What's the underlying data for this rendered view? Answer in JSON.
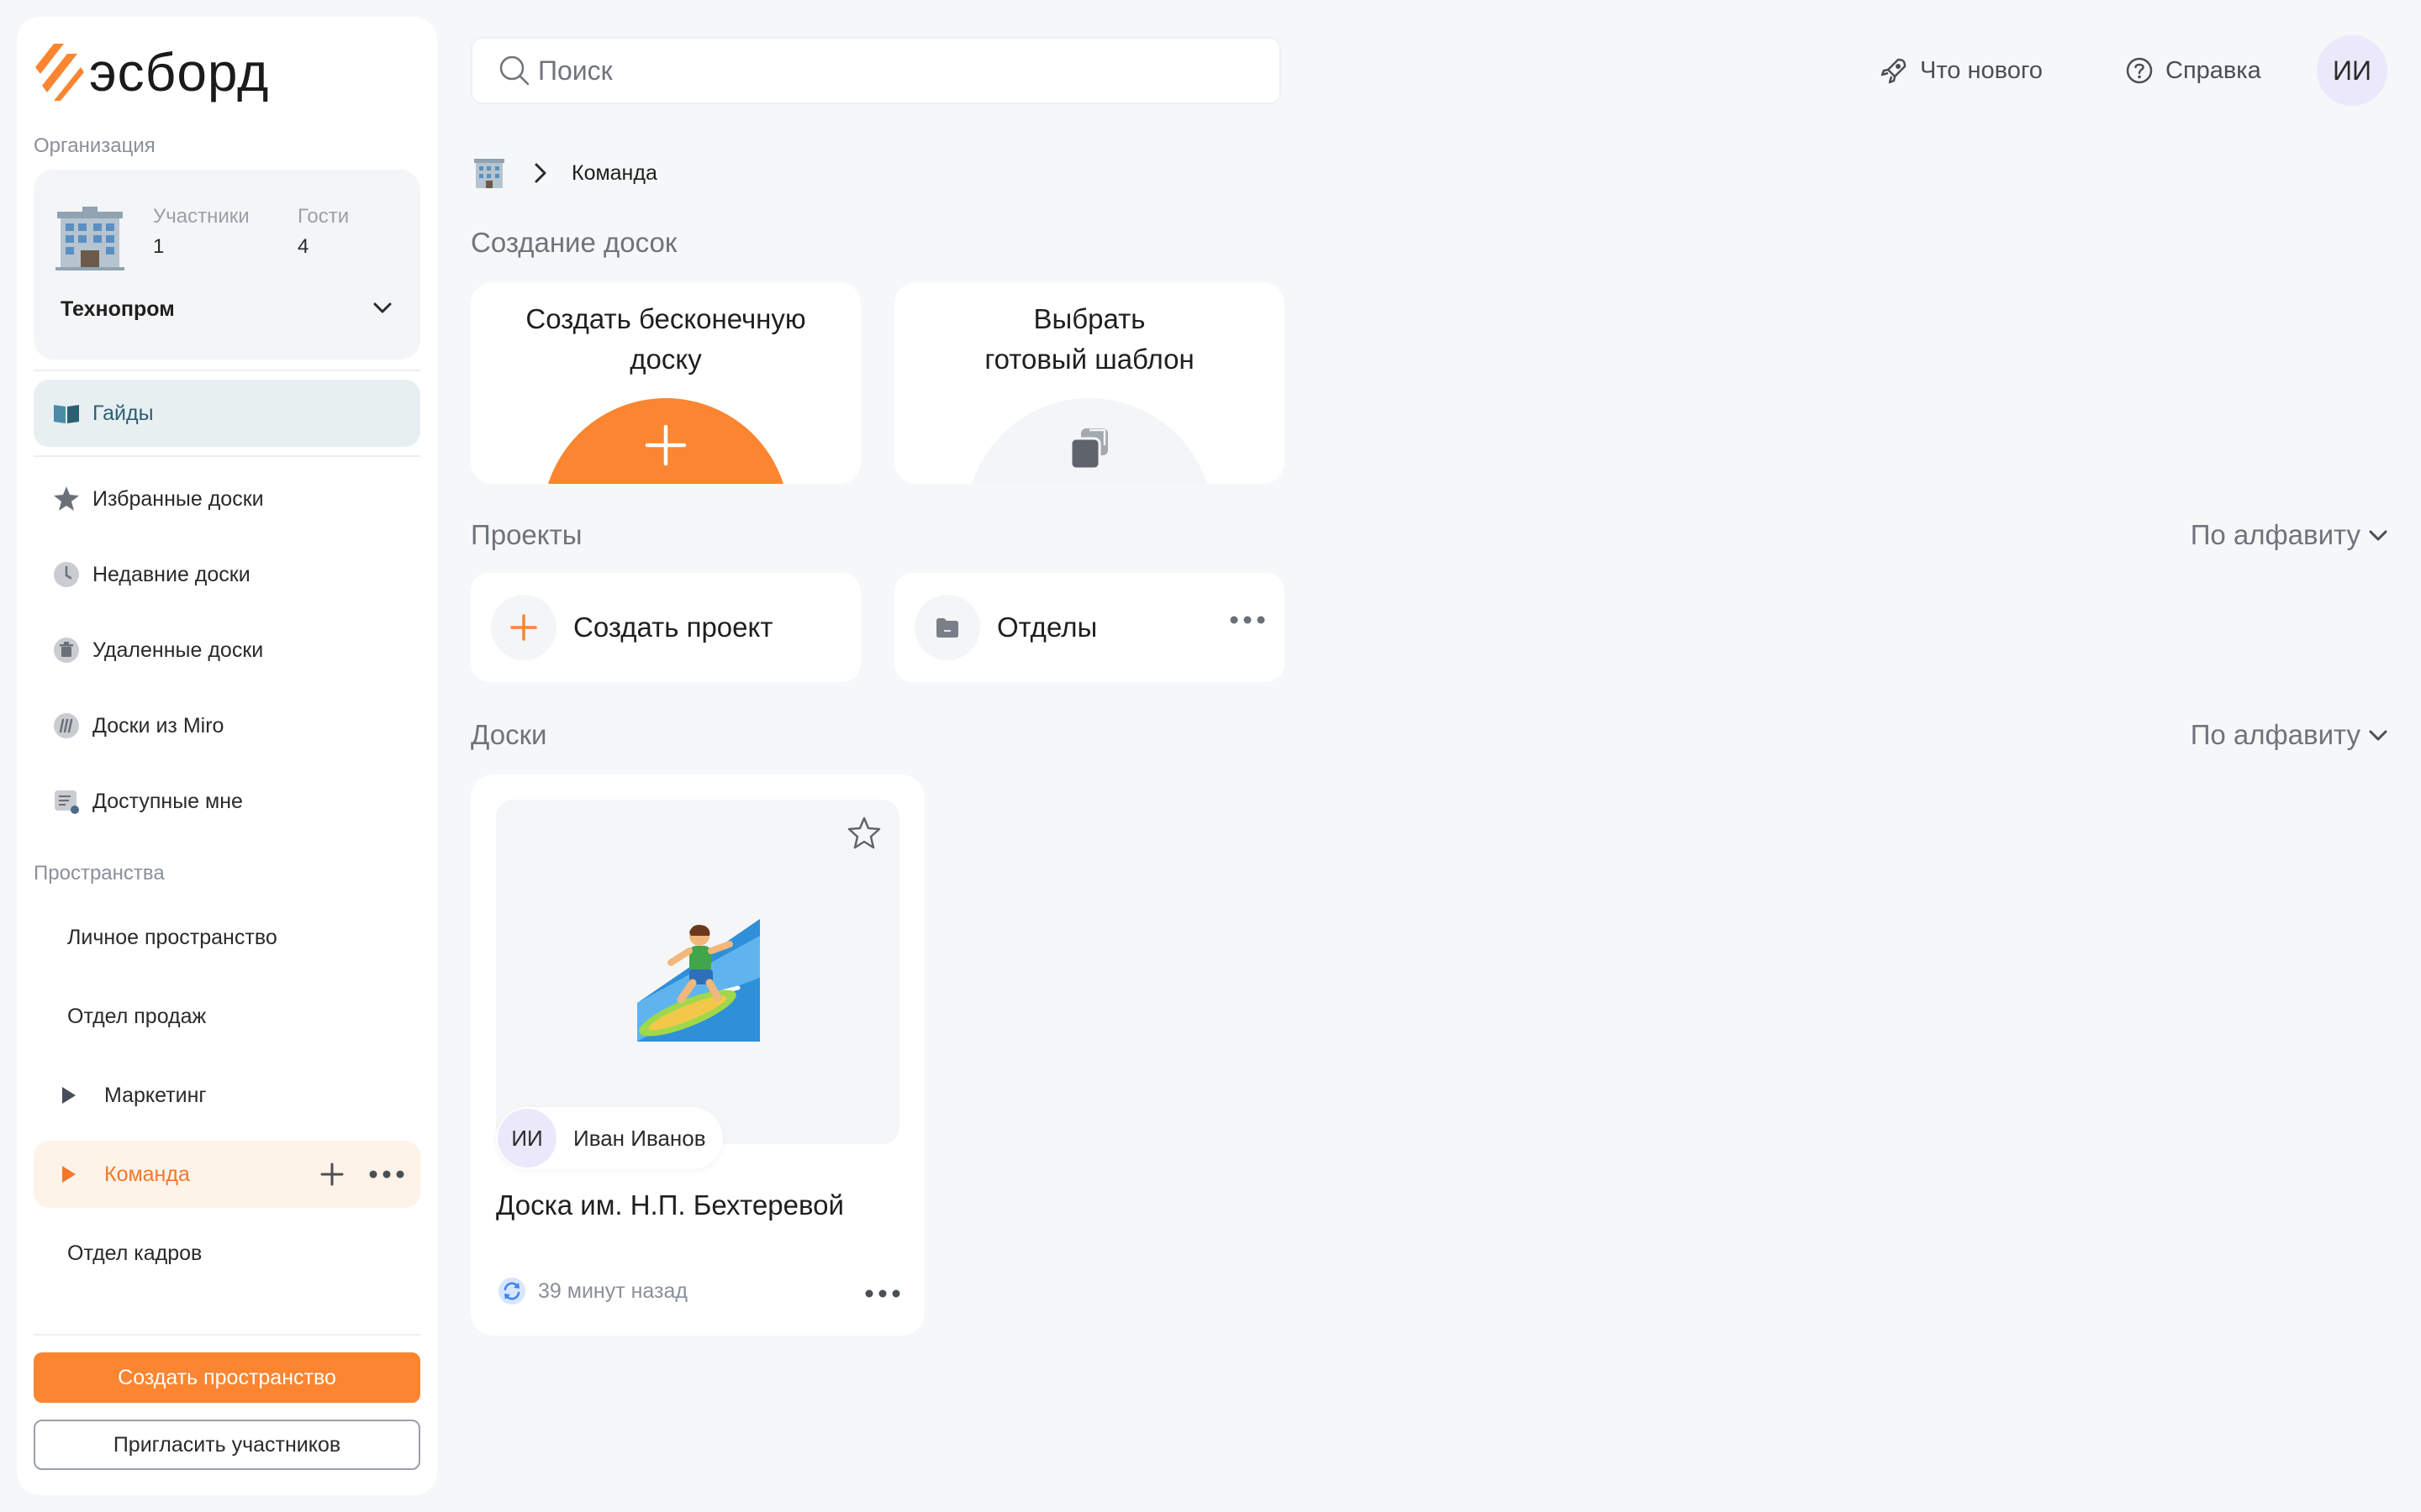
{
  "brand": {
    "name": "эсборд",
    "accent": "#fb8530"
  },
  "sidebar": {
    "org_label": "Организация",
    "org": {
      "members_label": "Участники",
      "members_value": "1",
      "guests_label": "Гости",
      "guests_value": "4",
      "name": "Технопром"
    },
    "guides": "Гайды",
    "nav": [
      {
        "label": "Избранные доски",
        "icon": "star-badge-icon"
      },
      {
        "label": "Недавние доски",
        "icon": "clock-icon"
      },
      {
        "label": "Удаленные доски",
        "icon": "trash-icon"
      },
      {
        "label": "Доски из Miro",
        "icon": "miro-icon"
      },
      {
        "label": "Доступные мне",
        "icon": "shared-doc-icon"
      }
    ],
    "spaces_label": "Пространства",
    "spaces": [
      {
        "label": "Личное пространство"
      },
      {
        "label": "Отдел продаж"
      },
      {
        "label": "Маркетинг"
      },
      {
        "label": "Команда"
      },
      {
        "label": "Отдел кадров"
      }
    ],
    "create_space": "Создать пространство",
    "invite": "Пригласить участников"
  },
  "topbar": {
    "search_placeholder": "Поиск",
    "whats_new": "Что нового",
    "help": "Справка",
    "user_initials": "ИИ"
  },
  "breadcrumb": {
    "current": "Команда"
  },
  "create_section": {
    "title": "Создание досок",
    "cards": [
      {
        "line1": "Создать бесконечную",
        "line2": "доску"
      },
      {
        "line1": "Выбрать",
        "line2": "готовый шаблон"
      }
    ]
  },
  "projects_section": {
    "title": "Проекты",
    "sort": "По алфавиту",
    "create": "Создать проект",
    "items": [
      {
        "label": "Отделы"
      }
    ]
  },
  "boards_section": {
    "title": "Доски",
    "sort": "По алфавиту",
    "boards": [
      {
        "title": "Доска им. Н.П. Бехтеревой",
        "owner_initials": "ИИ",
        "owner_name": "Иван Иванов",
        "updated": "39 минут назад",
        "emoji": "surfer-emoji"
      }
    ]
  }
}
